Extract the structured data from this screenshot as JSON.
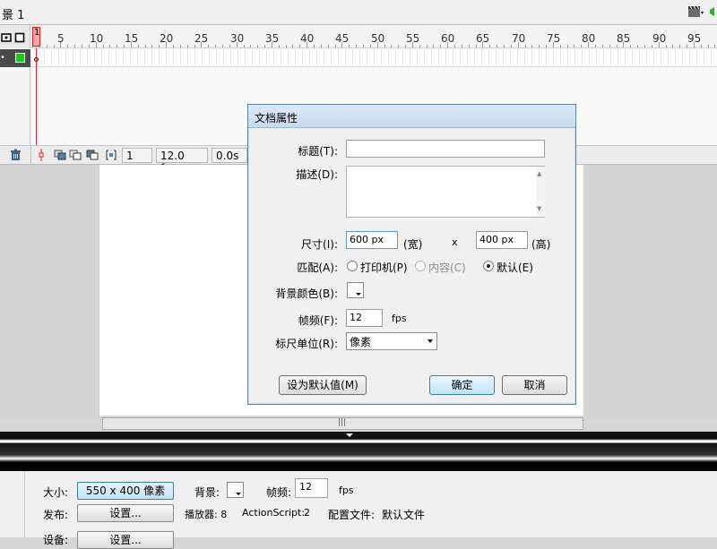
{
  "scene": {
    "label": "景 1"
  },
  "timeline": {
    "ruler_numbers": [
      "5",
      "10",
      "15",
      "20",
      "25",
      "30",
      "35",
      "40",
      "45",
      "50",
      "55",
      "60",
      "65",
      "70",
      "75",
      "80",
      "85",
      "90",
      "95"
    ],
    "current_frame": "1",
    "frame_rate": "12.0 fps",
    "elapsed": "0.0s"
  },
  "dialog": {
    "title": "文档属性",
    "title_label": "标题(T):",
    "desc_label": "描述(D):",
    "size_label": "尺寸(I):",
    "width_value": "600 px",
    "width_unit": "(宽)",
    "times": "x",
    "height_value": "400 px",
    "height_unit": "(高)",
    "match_label": "匹配(A):",
    "match_options": [
      "打印机(P)",
      "内容(C)",
      "默认(E)"
    ],
    "bg_color_label": "背景颜色(B):",
    "fps_label": "帧频(F):",
    "fps_value": "12",
    "fps_unit": "fps",
    "ruler_units_label": "标尺单位(R):",
    "ruler_units_value": "像素",
    "make_default_button": "设为默认值(M)",
    "ok_button": "确定",
    "cancel_button": "取消"
  },
  "properties": {
    "size_label": "大小:",
    "size_button": "550 x 400 像素",
    "bg_label": "背景:",
    "fps_label": "帧频:",
    "fps_value": "12",
    "fps_unit": "fps",
    "publish_label": "发布:",
    "settings_button": "设置...",
    "player_label": "播放器: 8",
    "actionscript_label": "ActionScript:",
    "actionscript_value": "2",
    "profile_label": "配置文件:",
    "profile_value": "默认文件",
    "device_label": "设备:",
    "device_button": "设置..."
  },
  "colors": {
    "accent": "#3c7fb1",
    "playhead": "#e0222a",
    "layer_green": "#22c32a"
  }
}
